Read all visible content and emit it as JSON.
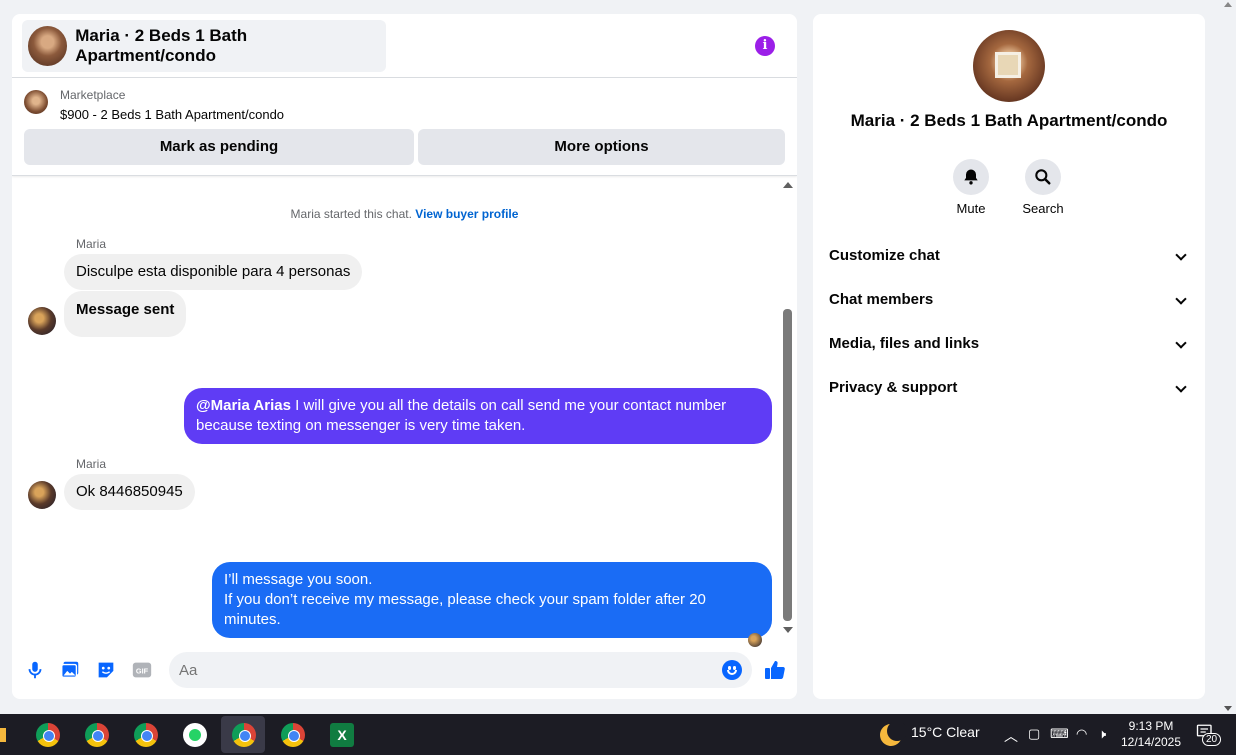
{
  "chat": {
    "title": "Maria · 2 Beds 1 Bath Apartment/condo",
    "listing_source": "Marketplace",
    "listing_title": "$900 - 2 Beds 1 Bath Apartment/condo",
    "btn_pending": "Mark as pending",
    "btn_more": "More options",
    "started_text": "Maria started this chat.",
    "view_profile": "View buyer profile",
    "messages": [
      {
        "sender": "Maria",
        "text": "Disculpe esta disponible para 4 personas"
      },
      {
        "text": "Message sent"
      },
      {
        "mention": "@Maria Arias",
        "text": " I will give you all the details on call send me your contact number because texting on messenger is very time taken."
      },
      {
        "sender": "Maria",
        "text": "Ok 8446850945"
      },
      {
        "line1": "I’ll message you soon.",
        "line2": "If you don’t receive my message, please check your spam folder after 20 minutes."
      }
    ],
    "composer_placeholder": "Aa",
    "gif_label": "GIF"
  },
  "info": {
    "name": "Maria · 2 Beds 1 Bath Apartment/condo",
    "mute": "Mute",
    "search": "Search",
    "sections": [
      "Customize chat",
      "Chat members",
      "Media, files and links",
      "Privacy & support"
    ]
  },
  "taskbar": {
    "weather": "15°C  Clear",
    "time": "9:13 PM",
    "date": "12/14/2025",
    "notifications": "20"
  },
  "colors": {
    "accent": "#0866ff",
    "purple_bubble": "#5f3cf5",
    "blue_bubble": "#1a6cf5"
  }
}
